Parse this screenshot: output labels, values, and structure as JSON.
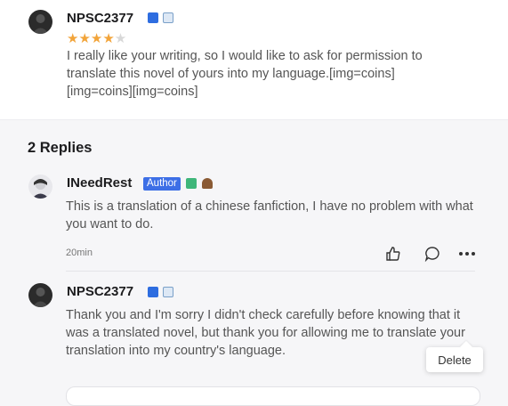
{
  "comment": {
    "username": "NPSC2377",
    "rating": 4,
    "rating_max": 5,
    "text": " I really like your writing, so I would like to ask for permission to translate this novel of yours into my language.[img=coins][img=coins][img=coins]"
  },
  "replies_header": "2 Replies",
  "replies": [
    {
      "username": "INeedRest",
      "tag": "Author",
      "text": "This is a translation of a chinese fanfiction, I have no problem with what you want to do.",
      "time": "20min"
    },
    {
      "username": "NPSC2377",
      "text": "Thank you and I'm sorry I didn't check carefully before knowing that it was a translated novel, but thank you for allowing me to translate your translation into my country's language."
    }
  ],
  "context_menu": {
    "delete_label": "Delete"
  },
  "icons": [
    "level-badge-icon",
    "landscape-badge-icon",
    "like-icon",
    "comment-icon",
    "more-icon"
  ],
  "colors": {
    "star": "#f2a43a",
    "author_tag": "#3d6fe6"
  }
}
